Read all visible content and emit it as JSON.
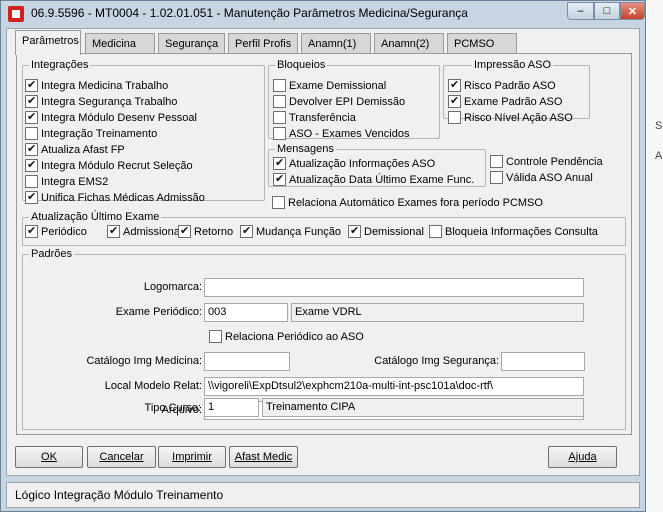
{
  "window": {
    "title": "06.9.5596 - MT0004 - 1.02.01.051 - Manutenção Parâmetros Medicina/Segurança",
    "minimize": "–",
    "maximize": "□",
    "close": "✕"
  },
  "tabs": [
    "Parâmetros",
    "Medicina",
    "Segurança",
    "Perfil Profis",
    "Anamn(1)",
    "Anamn(2)",
    "PCMSO"
  ],
  "integracoes": {
    "legend": "Integrações",
    "items": [
      {
        "label": "Integra Medicina Trabalho",
        "checked": true
      },
      {
        "label": "Integra Segurança Trabalho",
        "checked": true
      },
      {
        "label": "Integra Módulo Desenv Pessoal",
        "checked": true
      },
      {
        "label": "Integração Treinamento",
        "checked": false
      },
      {
        "label": "Atualiza Afast FP",
        "checked": true
      },
      {
        "label": "Integra Módulo Recrut Seleção",
        "checked": true
      },
      {
        "label": "Integra EMS2",
        "checked": false
      },
      {
        "label": "Unifica Fichas Médicas Admissão",
        "checked": true
      }
    ]
  },
  "bloqueios": {
    "legend": "Bloqueios",
    "items": [
      {
        "label": "Exame Demissional",
        "checked": false
      },
      {
        "label": "Devolver EPI Demissão",
        "checked": false
      },
      {
        "label": "Transferência",
        "checked": false
      },
      {
        "label": "ASO - Exames Vencidos",
        "checked": false
      }
    ]
  },
  "impressao": {
    "legend": "Impressão ASO",
    "items": [
      {
        "label": "Risco Padrão ASO",
        "checked": true
      },
      {
        "label": "Exame Padrão ASO",
        "checked": true
      },
      {
        "label": "Risco Nível Ação ASO",
        "checked": false
      }
    ]
  },
  "mensagens": {
    "legend": "Mensagens",
    "items": [
      {
        "label": "Atualização Informações ASO",
        "checked": true
      },
      {
        "label": "Atualização Data Último Exame Func.",
        "checked": true
      }
    ]
  },
  "extras": [
    {
      "label": "Controle Pendência",
      "checked": false
    },
    {
      "label": "Válida ASO Anual",
      "checked": false
    },
    {
      "label": "Relaciona Automático Exames fora período PCMSO",
      "checked": false
    }
  ],
  "ultimo_exame": {
    "legend": "Atualização Último Exame",
    "items": [
      {
        "label": "Periódico",
        "checked": true
      },
      {
        "label": "Admissional",
        "checked": true
      },
      {
        "label": "Retorno",
        "checked": true
      },
      {
        "label": "Mudança Função",
        "checked": true
      },
      {
        "label": "Demissional",
        "checked": true
      },
      {
        "label": "Bloqueia Informações Consulta",
        "checked": false
      }
    ]
  },
  "padroes": {
    "legend": "Padrões",
    "logomarca_label": "Logomarca:",
    "logomarca_value": "",
    "exame_periodico_label": "Exame Periódico:",
    "exame_periodico_code": "003",
    "exame_periodico_desc": "Exame VDRL",
    "relaciona_periodico": {
      "label": "Relaciona Periódico ao ASO",
      "checked": false
    },
    "catalogo_medicina_label": "Catálogo Img Medicina:",
    "catalogo_medicina_value": "",
    "catalogo_seguranca_label": "Catálogo Img Segurança:",
    "catalogo_seguranca_value": "",
    "local_modelo_label": "Local Modelo Relat:",
    "local_modelo_value": "\\\\vigoreli\\ExpDtsul2\\exphcm210a-multi-int-psc101a\\doc-rtf\\",
    "arquivo_label": "Arquivo:",
    "arquivo_value": "",
    "tipo_curso_label": "Tipo Curso:",
    "tipo_curso_code": "1",
    "tipo_curso_desc": "Treinamento CIPA"
  },
  "buttons": {
    "ok": "OK",
    "cancelar": "Cancelar",
    "imprimir": "Imprimir",
    "afast_medic": "Afast Medic",
    "ajuda": "Ajuda"
  },
  "status_text": "Lógico Integração Módulo Treinamento",
  "background_glyphs": [
    "S",
    "A"
  ],
  "colors": {
    "titlebar": "#c7d4e2",
    "close_button": "#c7432f",
    "panel": "#f0f0f0"
  }
}
